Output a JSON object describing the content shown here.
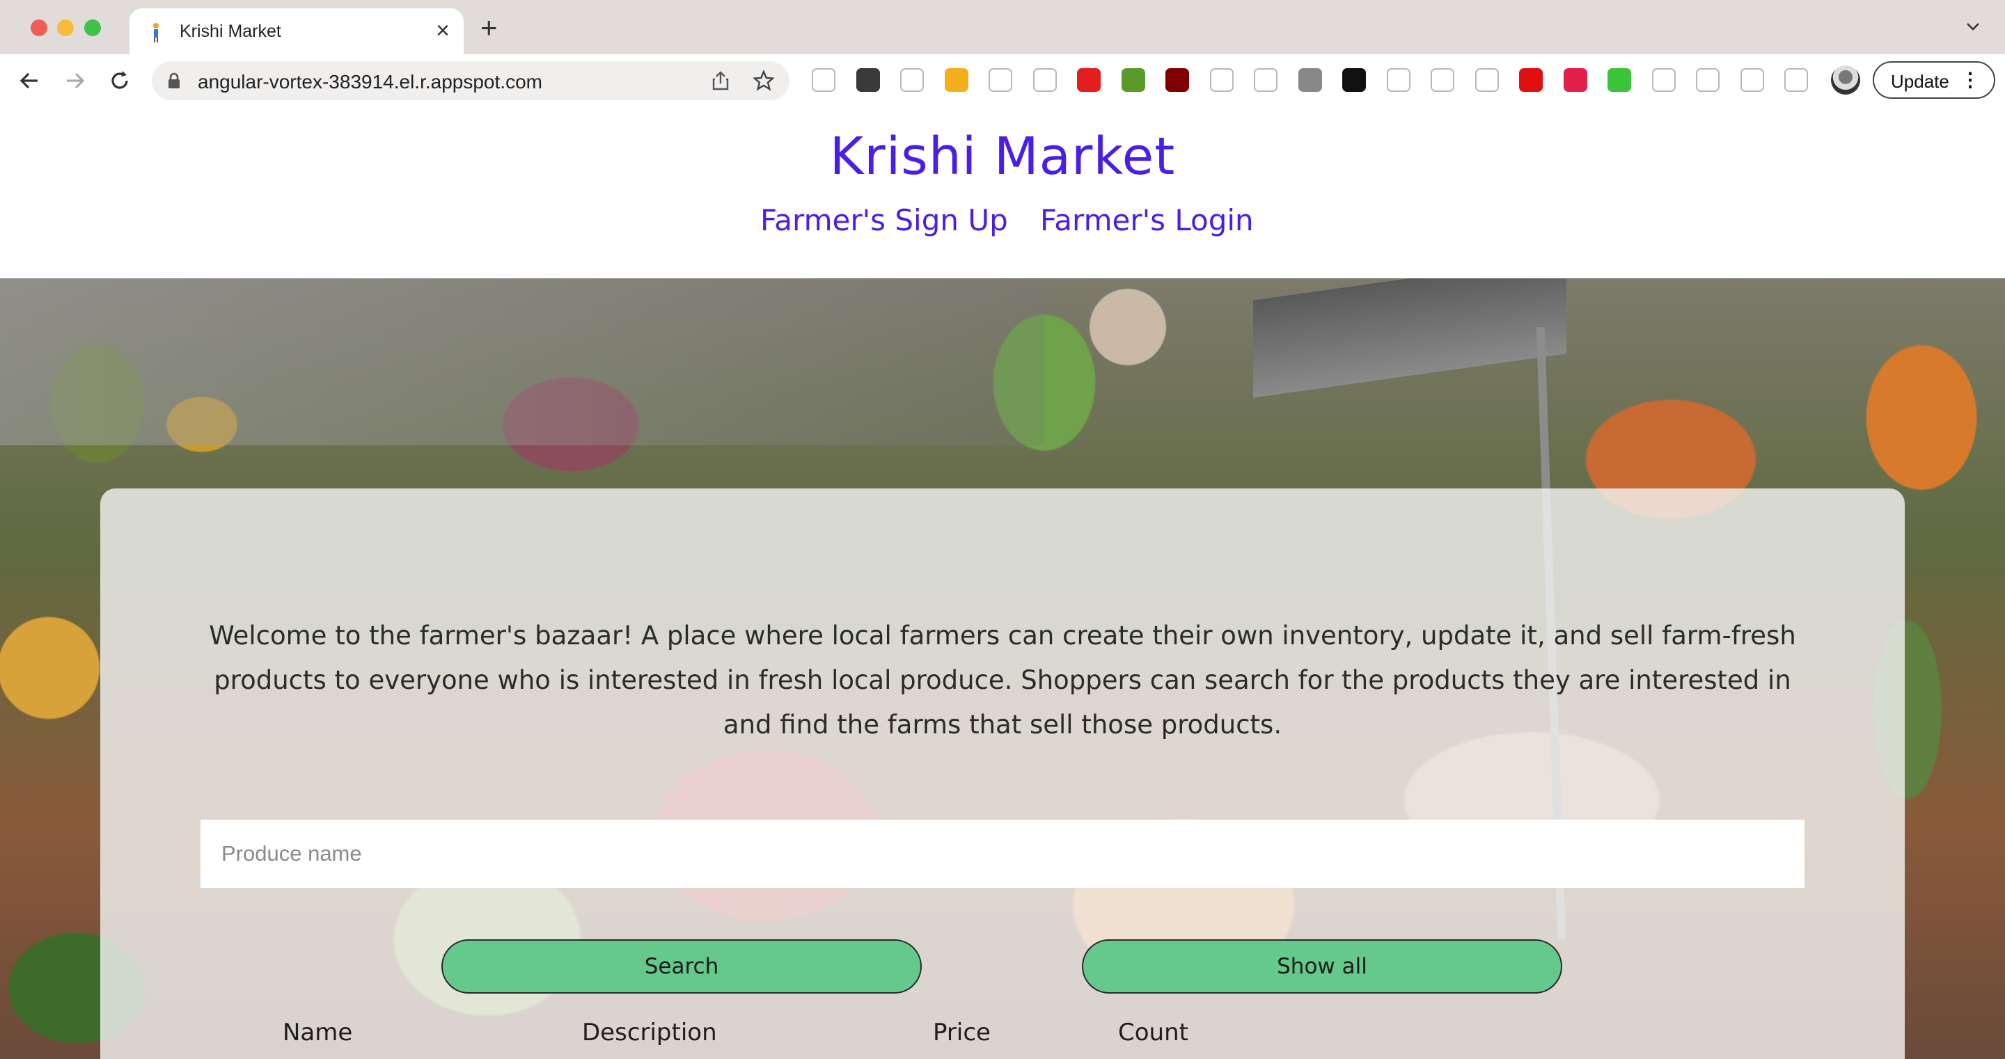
{
  "browser": {
    "tab_title": "Krishi Market",
    "url": "angular-vortex-383914.el.r.appspot.com",
    "update_label": "Update",
    "extensions": [
      {
        "icon": "pencil-icon",
        "color": "#ffffff"
      },
      {
        "icon": "lighthouse-icon",
        "color": "#3a3a3a"
      },
      {
        "icon": "wave-icon",
        "color": "#ffffff"
      },
      {
        "icon": "info-icon",
        "color": "#f2b020"
      },
      {
        "icon": "chess-icon",
        "color": "#ffffff"
      },
      {
        "icon": "tray-icon",
        "color": "#ffffff"
      },
      {
        "icon": "shield-red-icon",
        "color": "#e41e1e"
      },
      {
        "icon": "plus-circle-icon",
        "color": "#5a9a2a"
      },
      {
        "icon": "ublock-icon",
        "color": "#800000"
      },
      {
        "icon": "chart-icon",
        "color": "#ffffff"
      },
      {
        "icon": "clock-icon",
        "color": "#ffffff"
      },
      {
        "icon": "image-icon",
        "color": "#888888"
      },
      {
        "icon": "tampermonkey-icon",
        "color": "#111111"
      },
      {
        "icon": "bars-icon",
        "color": "#ffffff"
      },
      {
        "icon": "color-bars-icon",
        "color": "#ffffff"
      },
      {
        "icon": "outline-bars-icon",
        "color": "#ffffff"
      },
      {
        "icon": "youtube-forward-icon",
        "color": "#e01010"
      },
      {
        "icon": "play-circle-icon",
        "color": "#e0204a"
      },
      {
        "icon": "lock-green-icon",
        "color": "#3ac43a"
      },
      {
        "icon": "omega-icon",
        "color": "#ffffff"
      },
      {
        "icon": "c-icon",
        "color": "#ffffff"
      },
      {
        "icon": "puzzle-icon",
        "color": "#ffffff"
      },
      {
        "icon": "sidepanel-icon",
        "color": "#ffffff"
      }
    ]
  },
  "site": {
    "title": "Krishi Market",
    "nav": {
      "signup": "Farmer's Sign Up",
      "login": "Farmer's Login"
    },
    "welcome_text": "Welcome to the farmer's bazaar! A place where local farmers can create their own inventory, update it, and sell farm-fresh products to everyone who is interested in fresh local produce. Shoppers can search for the products they are interested in and find the farms that sell those products.",
    "search": {
      "placeholder": "Produce name",
      "value": ""
    },
    "buttons": {
      "search": "Search",
      "show_all": "Show all"
    },
    "table_headers": [
      "Name",
      "Description",
      "Price",
      "Count"
    ]
  },
  "colors": {
    "brand": "#4a1ee6",
    "button": "#64c98a"
  }
}
